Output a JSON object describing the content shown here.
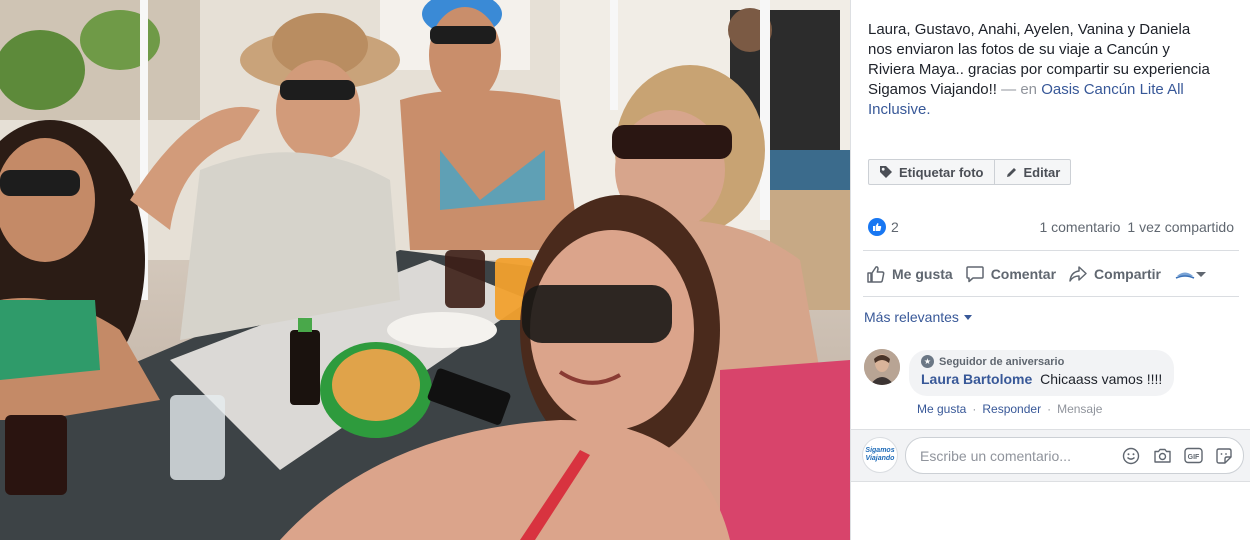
{
  "post": {
    "caption_text": "Laura, Gustavo, Anahi, Ayelen, Vanina y Daniela nos enviaron las fotos de su viaje a Cancún y Riviera Maya.. gracias por compartir su experiencia Sigamos Viajando!!",
    "caption_at": "— en",
    "caption_place": "Oasis Cancún Lite All Inclusive."
  },
  "buttons": {
    "tag_photo": "Etiquetar foto",
    "edit": "Editar"
  },
  "stats": {
    "reaction_count": "2",
    "comments": "1 comentario",
    "shares": "1 vez compartido"
  },
  "actions": {
    "like": "Me gusta",
    "comment": "Comentar",
    "share": "Compartir"
  },
  "sort": {
    "label": "Más relevantes"
  },
  "comment": {
    "badge": "Seguidor de aniversario",
    "author": "Laura Bartolome",
    "text": "Chicaass vamos !!!!",
    "like_link": "Me gusta",
    "reply_link": "Responder",
    "message_link": "Mensaje"
  },
  "composer": {
    "placeholder": "Escribe un comentario...",
    "page_logo_line1": "Sigamos",
    "page_logo_line2": "Viajando"
  },
  "colors": {
    "link": "#385898",
    "like_blue": "#1877f2",
    "meta_gray": "#606770"
  },
  "icons": [
    "tag-icon",
    "pencil-icon",
    "like-thumb-icon",
    "comment-bubble-icon",
    "share-arrow-icon",
    "emoji-icon",
    "camera-icon",
    "gif-icon",
    "sticker-icon",
    "caret-down-icon"
  ]
}
